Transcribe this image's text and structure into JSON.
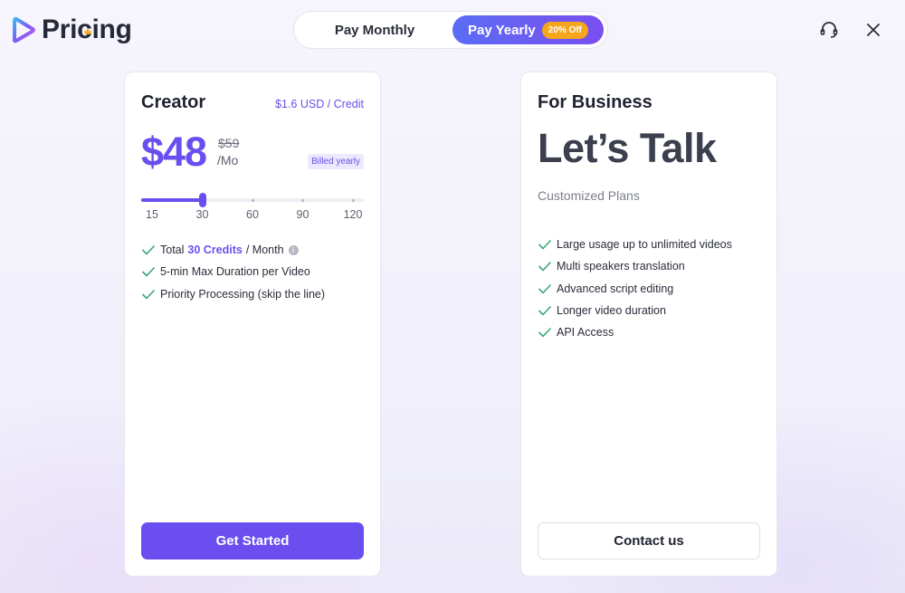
{
  "header": {
    "brand": "Pricing",
    "toggle": {
      "monthly_label": "Pay Monthly",
      "yearly_label": "Pay Yearly",
      "discount_badge": "20% Off",
      "selected": "yearly"
    },
    "icons": [
      "support-headset-icon",
      "close-icon"
    ]
  },
  "creator": {
    "title": "Creator",
    "credit_rate": "$1.6 USD / Credit",
    "price": "$48",
    "old_price": "$59",
    "period": "/Mo",
    "billed": "Billed yearly",
    "slider": {
      "options": [
        "15",
        "30",
        "60",
        "90",
        "120"
      ],
      "selected": "30",
      "fill_fraction": 0.25
    },
    "features": {
      "credits_prefix": "Total",
      "credits_value": "30 Credits",
      "credits_suffix": "/ Month",
      "f2": "5-min Max Duration per Video",
      "f3": "Priority Processing (skip the line)"
    },
    "cta": "Get Started"
  },
  "business": {
    "title": "For Business",
    "headline": "Let’s Talk",
    "subtitle": "Customized Plans",
    "features": [
      "Large usage up to unlimited videos",
      "Multi speakers translation",
      "Advanced script editing",
      "Longer video duration",
      "API Access"
    ],
    "cta": "Contact us"
  },
  "colors": {
    "accent": "#6b4ef0",
    "check": "#3aa776",
    "badge": "#f7a51b"
  }
}
